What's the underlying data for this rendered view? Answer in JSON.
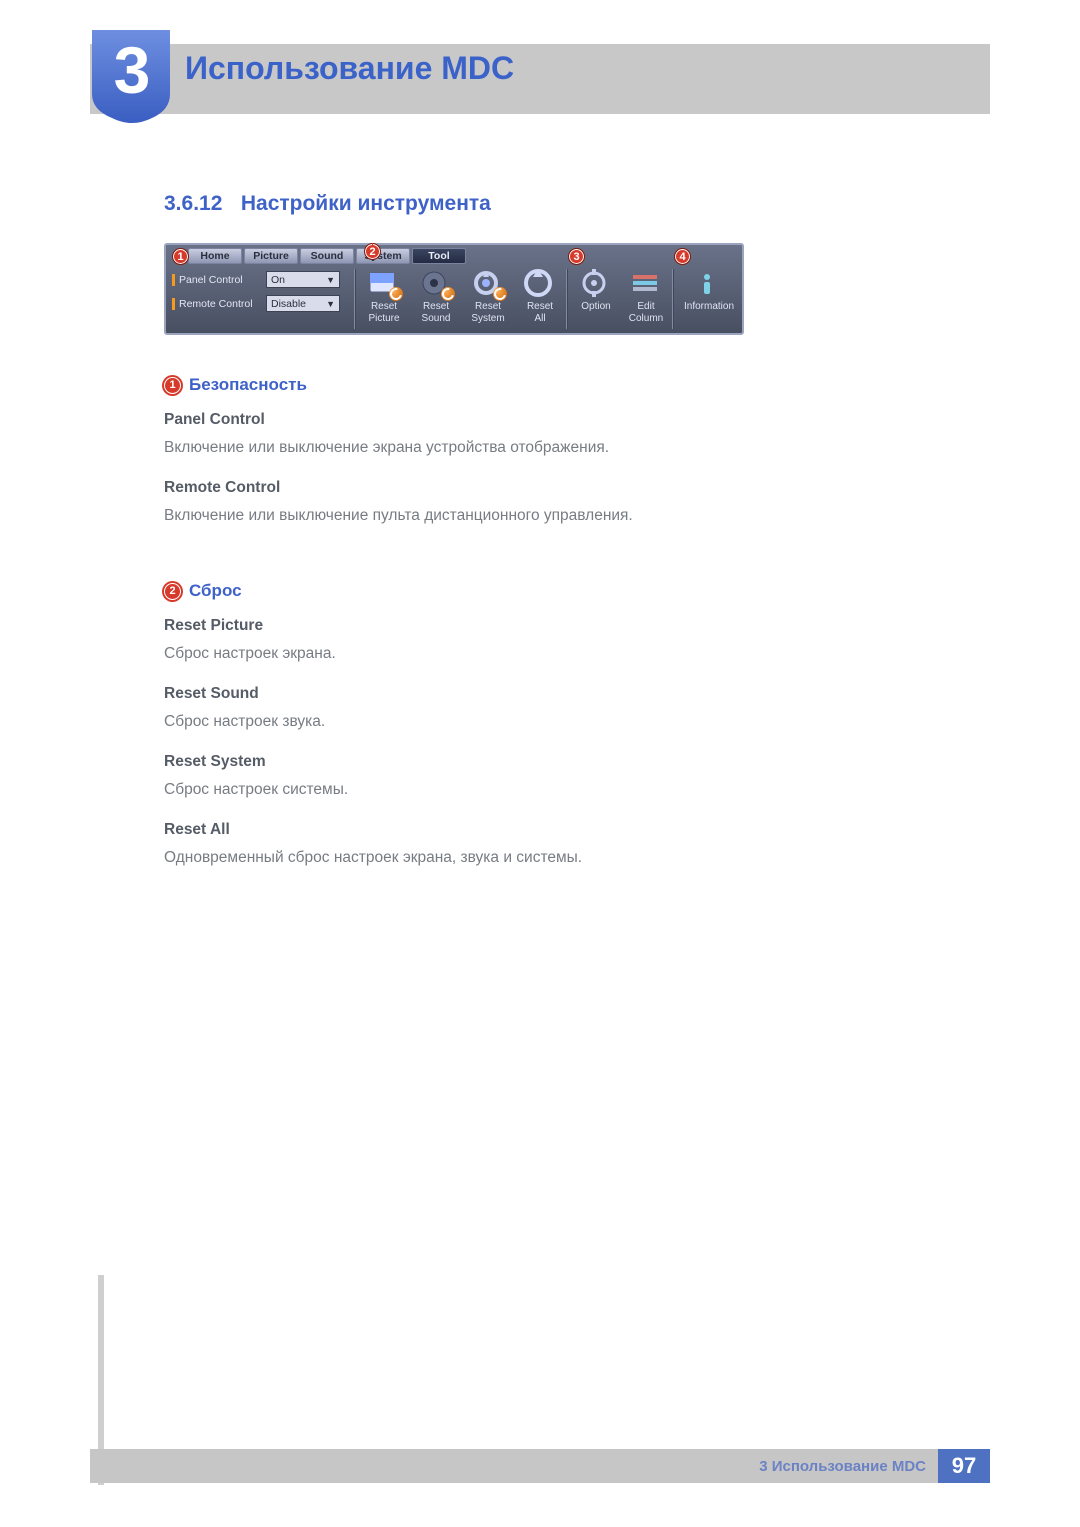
{
  "chapter": {
    "number": "3",
    "title": "Использование MDC"
  },
  "section": {
    "number": "3.6.12",
    "title": "Настройки инструмента"
  },
  "ui": {
    "tabs": [
      "Home",
      "Picture",
      "Sound",
      "System",
      "Tool"
    ],
    "controls": {
      "panel_control": {
        "label": "Panel Control",
        "value": "On"
      },
      "remote_control": {
        "label": "Remote Control",
        "value": "Disable"
      }
    },
    "tools": {
      "reset_picture": {
        "line1": "Reset",
        "line2": "Picture"
      },
      "reset_sound": {
        "line1": "Reset",
        "line2": "Sound"
      },
      "reset_system": {
        "line1": "Reset",
        "line2": "System"
      },
      "reset_all": {
        "line1": "Reset",
        "line2": "All"
      },
      "option": {
        "line1": "Option",
        "line2": ""
      },
      "edit_column": {
        "line1": "Edit",
        "line2": "Column"
      },
      "information": {
        "line1": "Information",
        "line2": ""
      }
    },
    "callouts": {
      "c1": "1",
      "c2": "2",
      "c3": "3",
      "c4": "4"
    }
  },
  "sections": {
    "security": {
      "badge": "1",
      "title": "Безопасность",
      "panel_control": {
        "heading": "Panel Control",
        "text": "Включение или выключение экрана устройства отображения."
      },
      "remote_control": {
        "heading": "Remote Control",
        "text": "Включение или выключение пульта дистанционного управления."
      }
    },
    "reset": {
      "badge": "2",
      "title": "Сброс",
      "reset_picture": {
        "heading": "Reset Picture",
        "text": "Сброс настроек экрана."
      },
      "reset_sound": {
        "heading": "Reset Sound",
        "text": "Сброс настроек звука."
      },
      "reset_system": {
        "heading": "Reset System",
        "text": "Сброс настроек системы."
      },
      "reset_all": {
        "heading": "Reset All",
        "text": "Одновременный сброс настроек экрана, звука и системы."
      }
    }
  },
  "footer": {
    "text": "3 Использование MDC",
    "page": "97"
  }
}
